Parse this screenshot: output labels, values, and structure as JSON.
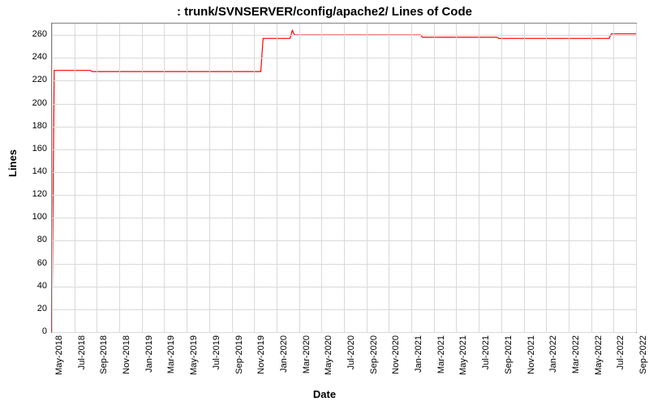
{
  "chart_data": {
    "type": "line",
    "title": ": trunk/SVNSERVER/config/apache2/ Lines of Code",
    "xlabel": "Date",
    "ylabel": "Lines",
    "ylim": [
      0,
      270
    ],
    "x_categories": [
      "May-2018",
      "Jul-2018",
      "Sep-2018",
      "Nov-2018",
      "Jan-2019",
      "Mar-2019",
      "May-2019",
      "Jul-2019",
      "Sep-2019",
      "Nov-2019",
      "Jan-2020",
      "Mar-2020",
      "May-2020",
      "Jul-2020",
      "Sep-2020",
      "Nov-2020",
      "Jan-2021",
      "Mar-2021",
      "May-2021",
      "Jul-2021",
      "Sep-2021",
      "Nov-2021",
      "Jan-2022",
      "Mar-2022",
      "May-2022",
      "Jul-2022",
      "Sep-2022"
    ],
    "y_ticks": [
      0,
      20,
      40,
      60,
      80,
      100,
      120,
      140,
      160,
      180,
      200,
      220,
      240,
      260
    ],
    "series": [
      {
        "name": "Lines of Code",
        "color": "#ff0000",
        "points": [
          {
            "xi": 0.0,
            "y": 0
          },
          {
            "xi": 0.1,
            "y": 229
          },
          {
            "xi": 1.7,
            "y": 229
          },
          {
            "xi": 1.8,
            "y": 228
          },
          {
            "xi": 9.3,
            "y": 228
          },
          {
            "xi": 9.4,
            "y": 257
          },
          {
            "xi": 10.6,
            "y": 257
          },
          {
            "xi": 10.7,
            "y": 264
          },
          {
            "xi": 10.8,
            "y": 260
          },
          {
            "xi": 16.4,
            "y": 260
          },
          {
            "xi": 16.5,
            "y": 258
          },
          {
            "xi": 19.8,
            "y": 258
          },
          {
            "xi": 19.9,
            "y": 257
          },
          {
            "xi": 24.8,
            "y": 257
          },
          {
            "xi": 24.9,
            "y": 261
          },
          {
            "xi": 26.0,
            "y": 261
          }
        ]
      }
    ]
  }
}
